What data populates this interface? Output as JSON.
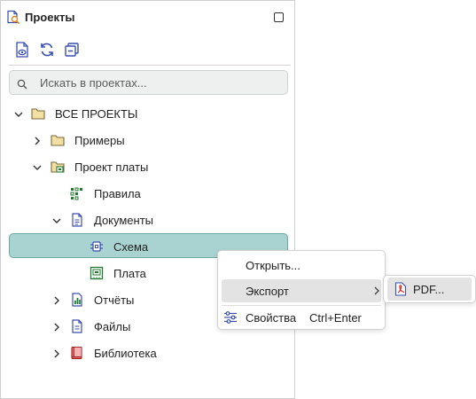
{
  "panel": {
    "title": "Проекты",
    "search": {
      "placeholder": "Искать в проектах..."
    }
  },
  "tree": {
    "items": [
      {
        "label": "ВСЕ ПРОЕКТЫ",
        "icon": "folder-icon"
      },
      {
        "label": "Примеры",
        "icon": "folder-icon"
      },
      {
        "label": "Проект платы",
        "icon": "board-project-icon"
      },
      {
        "label": "Правила",
        "icon": "rules-icon"
      },
      {
        "label": "Документы",
        "icon": "documents-icon"
      },
      {
        "label": "Схема",
        "icon": "schematic-icon",
        "selected": true
      },
      {
        "label": "Плата",
        "icon": "pcb-icon"
      },
      {
        "label": "Отчёты",
        "icon": "reports-icon"
      },
      {
        "label": "Файлы",
        "icon": "files-icon"
      },
      {
        "label": "Библиотека",
        "icon": "library-icon"
      }
    ]
  },
  "context_menu": {
    "open": "Открыть...",
    "export": "Экспорт",
    "properties": "Свойства",
    "properties_shortcut": "Ctrl+Enter"
  },
  "submenu": {
    "pdf": "PDF..."
  },
  "colors": {
    "selection_bg": "#a9d3d1",
    "selection_border": "#6fa9a6",
    "icon_blue": "#3a4fb0",
    "icon_green": "#1f7a2e",
    "folder": "#f3dfa3"
  }
}
